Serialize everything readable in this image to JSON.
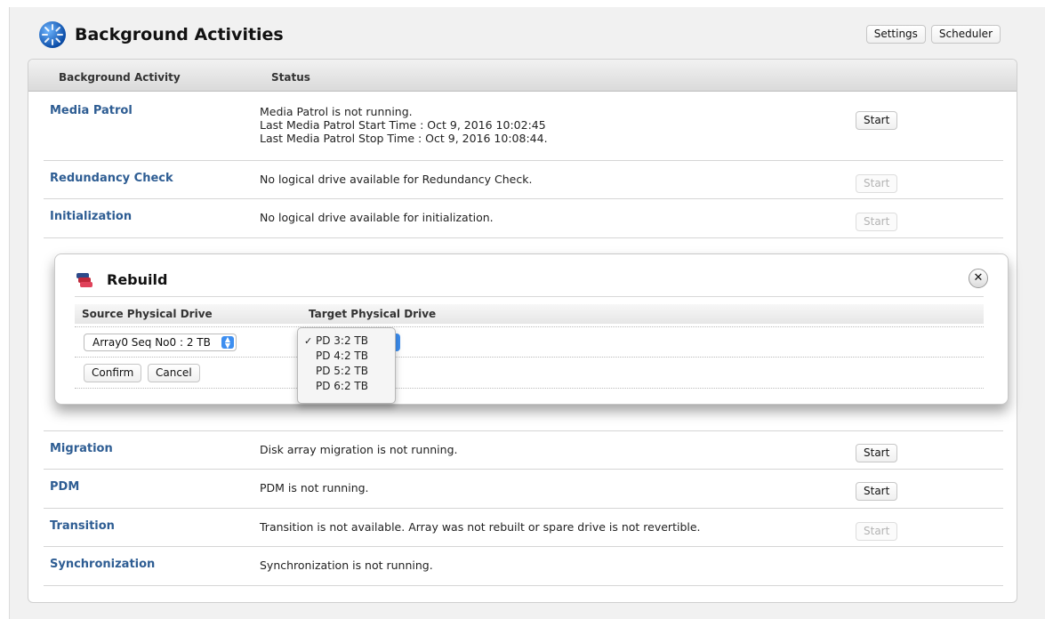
{
  "header": {
    "title": "Background Activities",
    "icon": "spinner-gear-icon",
    "buttons": {
      "settings": "Settings",
      "scheduler": "Scheduler"
    }
  },
  "table": {
    "columns": {
      "activity": "Background Activity",
      "status": "Status"
    },
    "rows": [
      {
        "name": "Media Patrol",
        "status": [
          "Media Patrol is not running.",
          "Last Media Patrol Start Time : Oct 9, 2016 10:02:45",
          "Last Media Patrol Stop Time : Oct 9, 2016 10:08:44."
        ],
        "action": "Start",
        "enabled": true
      },
      {
        "name": "Redundancy Check",
        "status": [
          "No logical drive available for Redundancy Check."
        ],
        "action": "Start",
        "enabled": false
      },
      {
        "name": "Initialization",
        "status": [
          "No logical drive available for initialization."
        ],
        "action": "Start",
        "enabled": false
      },
      {
        "name": "Migration",
        "status": [
          "Disk array migration is not running."
        ],
        "action": "Start",
        "enabled": true
      },
      {
        "name": "PDM",
        "status": [
          "PDM is not running."
        ],
        "action": "Start",
        "enabled": true
      },
      {
        "name": "Transition",
        "status": [
          "Transition is not available. Array was not rebuilt or spare drive is not revertible."
        ],
        "action": "Start",
        "enabled": false
      },
      {
        "name": "Synchronization",
        "status": [
          "Synchronization is not running."
        ],
        "action": "",
        "enabled": false
      }
    ]
  },
  "rebuild_dialog": {
    "title": "Rebuild",
    "icon": "drive-stack-icon",
    "close_icon": "close-icon",
    "columns": {
      "source": "Source Physical Drive",
      "target": "Target Physical Drive"
    },
    "source_value": "Array0 Seq No0 : 2 TB",
    "target_options": [
      "PD 3:2 TB",
      "PD 4:2 TB",
      "PD 5:2 TB",
      "PD 6:2 TB"
    ],
    "target_selected": "PD 3:2 TB",
    "confirm_label": "Confirm",
    "cancel_label": "Cancel"
  }
}
